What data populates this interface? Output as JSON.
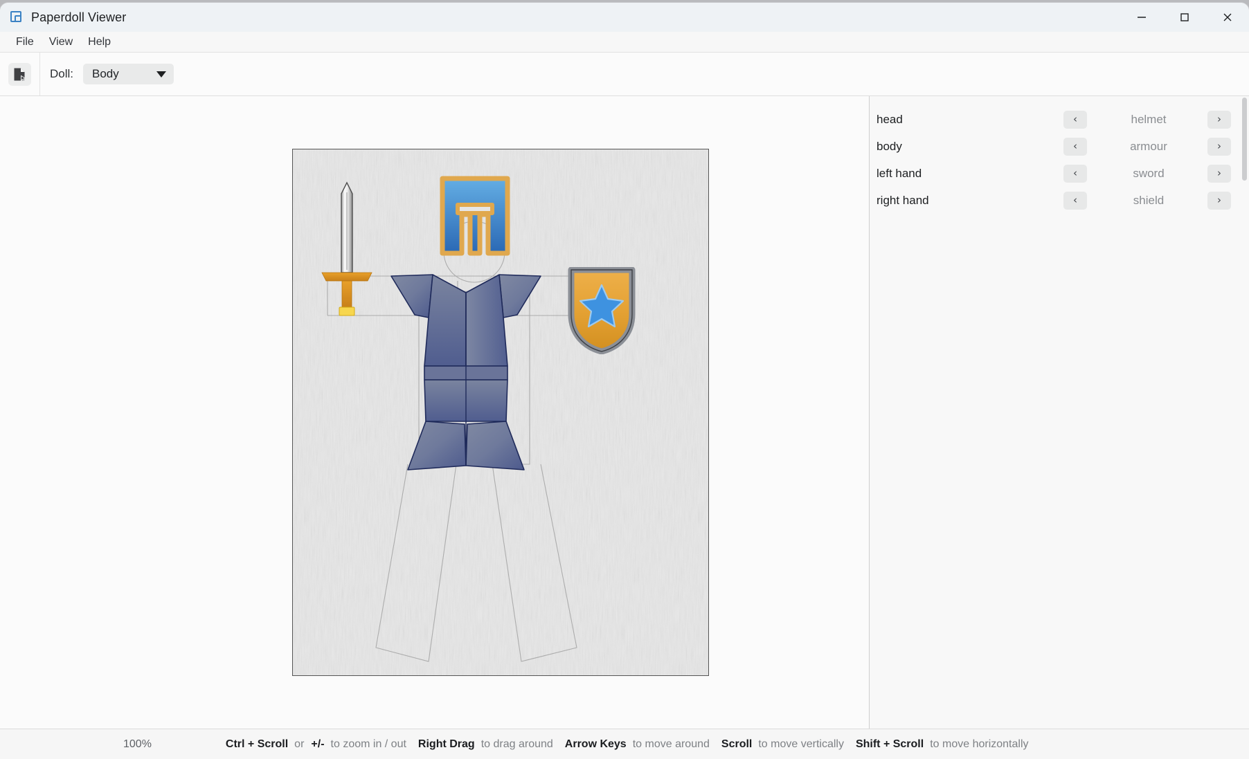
{
  "window": {
    "title": "Paperdoll Viewer",
    "app_icon": "paperdoll-app-icon",
    "controls": {
      "minimize": "minimize-icon",
      "maximize": "maximize-icon",
      "close": "close-icon"
    }
  },
  "menubar": {
    "items": [
      {
        "label": "File"
      },
      {
        "label": "View"
      },
      {
        "label": "Help"
      }
    ]
  },
  "toolbar": {
    "open_icon": "open-document-icon",
    "doll_label": "Doll:",
    "doll_value": "Body",
    "doll_options": [
      "Body"
    ],
    "dropdown_icon": "chevron-down-icon"
  },
  "canvas": {
    "background": "#e6e6e6",
    "sprites": {
      "helmet": {
        "name": "helmet",
        "fill_top": "#5aa8e0",
        "fill_bottom": "#2f6fb8",
        "border": "#e0a84e"
      },
      "armour": {
        "name": "armour",
        "fill_light": "#7b86a4",
        "fill_dark": "#505d8e",
        "outline": "#1f2a5a"
      },
      "sword": {
        "name": "sword",
        "blade": "#f0f0f0",
        "blade_edge": "#6e6e6e",
        "hilt": "#d98c1f",
        "pommel": "#f6d24a"
      },
      "shield": {
        "name": "shield",
        "border": "#8b8f96",
        "fill_top": "#e8a73a",
        "fill_bottom": "#d99424",
        "star": "#3e92e0"
      }
    }
  },
  "side_panel": {
    "prev_icon": "chevron-left-icon",
    "next_icon": "chevron-right-icon",
    "slots": [
      {
        "slot": "head",
        "value": "helmet"
      },
      {
        "slot": "body",
        "value": "armour"
      },
      {
        "slot": "left hand",
        "value": "sword"
      },
      {
        "slot": "right hand",
        "value": "shield"
      }
    ]
  },
  "statusbar": {
    "zoom": "100%",
    "hints": [
      {
        "key": "Ctrl + Scroll",
        "sep": "or",
        "key2": "+/-",
        "text": "to zoom in / out"
      },
      {
        "key": "Right Drag",
        "text": "to drag around"
      },
      {
        "key": "Arrow Keys",
        "text": "to move around"
      },
      {
        "key": "Scroll",
        "text": "to move vertically"
      },
      {
        "key": "Shift + Scroll",
        "text": "to move horizontally"
      }
    ]
  }
}
